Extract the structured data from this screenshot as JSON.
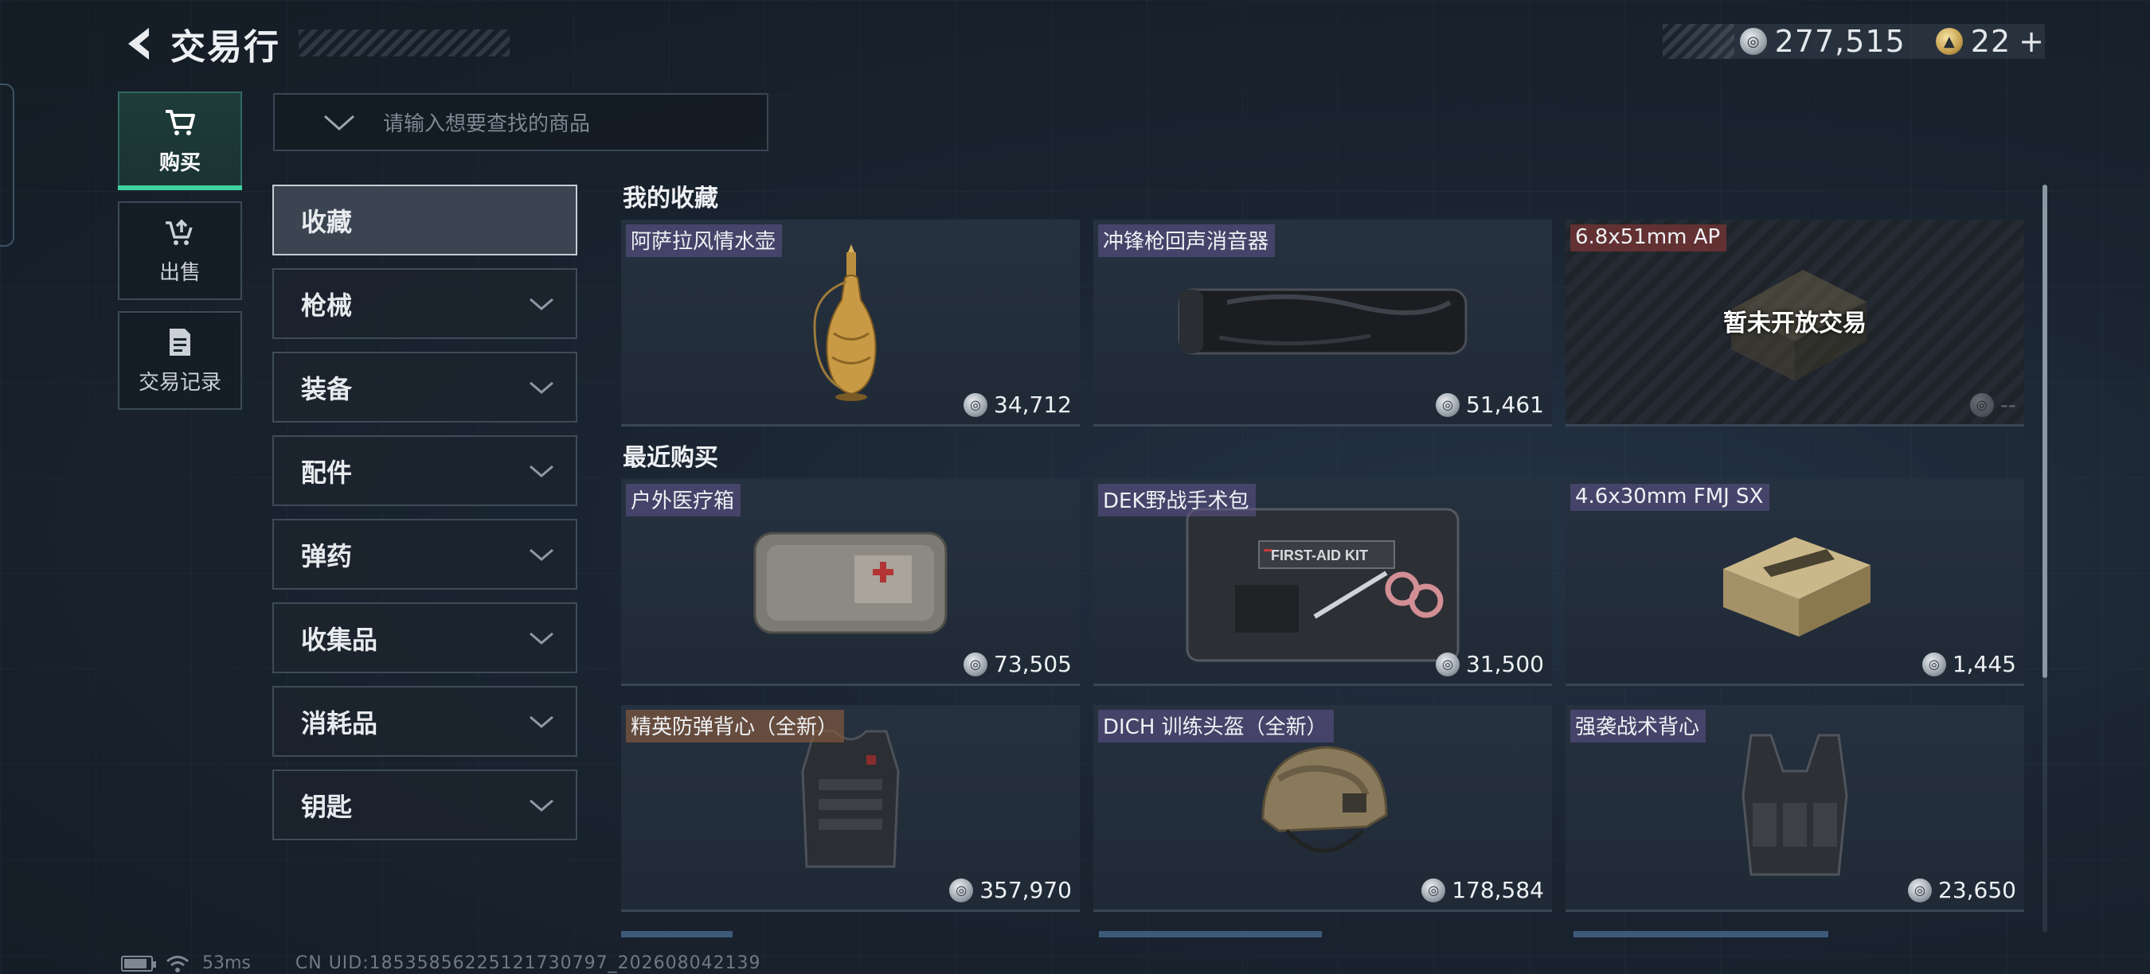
{
  "header": {
    "title": "交易行"
  },
  "currency": {
    "silver": "277,515",
    "gold": "22",
    "gold_add": "+"
  },
  "nav": [
    {
      "label": "购买",
      "icon": "cart-icon",
      "active": true
    },
    {
      "label": "出售",
      "icon": "sell-icon",
      "active": false
    },
    {
      "label": "交易记录",
      "icon": "record-icon",
      "active": false
    }
  ],
  "search": {
    "placeholder": "请输入想要查找的商品"
  },
  "categories": [
    "收藏",
    "枪械",
    "装备",
    "配件",
    "弹药",
    "收集品",
    "消耗品",
    "钥匙"
  ],
  "sections": [
    {
      "title": "我的收藏",
      "items": [
        {
          "name": "阿萨拉风情水壶",
          "price": "34,712",
          "icon": "ornate-vase-icon"
        },
        {
          "name": "冲锋枪回声消音器",
          "price": "51,461",
          "icon": "suppressor-icon"
        },
        {
          "name": "6.8x51mm AP",
          "price": "--",
          "icon": "ammo-box-icon",
          "locked_text": "暂未开放交易"
        }
      ]
    },
    {
      "title": "最近购买",
      "items": [
        {
          "name": "户外医疗箱",
          "price": "73,505",
          "icon": "medical-bag-icon"
        },
        {
          "name": "DEK野战手术包",
          "price": "31,500",
          "icon": "surgery-kit-icon"
        },
        {
          "name": "4.6x30mm FMJ SX",
          "price": "1,445",
          "icon": "ammo-box-icon"
        },
        {
          "name": "精英防弹背心（全新）",
          "price": "357,970",
          "icon": "body-armor-icon"
        },
        {
          "name": "DICH 训练头盔（全新）",
          "price": "178,584",
          "icon": "helmet-icon"
        },
        {
          "name": "强袭战术背心",
          "price": "23,650",
          "icon": "tactical-vest-icon"
        }
      ]
    }
  ],
  "status": {
    "ping": "53ms",
    "uid": "CN UID:18535856225121730797_202608042139"
  }
}
